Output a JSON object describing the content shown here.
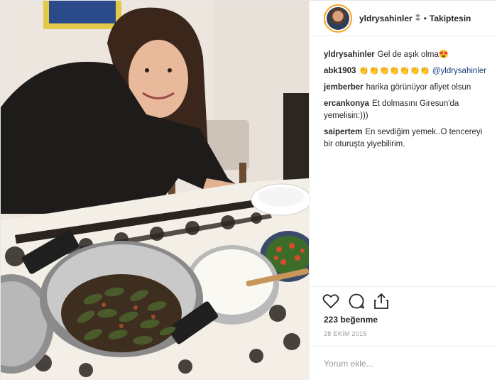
{
  "post": {
    "username": "yldrysahinler",
    "verified_glyph": "⭘",
    "follow_status": "Takiptesin",
    "likes": "223 beğenme",
    "date": "28 EKİM 2015",
    "comment_placeholder": "Yorum ekle..."
  },
  "comments": [
    {
      "user": "yldrysahinler",
      "text": "Gel de aşık olma😍",
      "mention": ""
    },
    {
      "user": "abk1903",
      "text": "👏👏👏👏👏👏👏 ",
      "mention": "@yldrysahinler"
    },
    {
      "user": "jemberber",
      "text": "harika görünüyor afiyet olsun",
      "mention": ""
    },
    {
      "user": "ercankonya",
      "text": "Et dolmasını Giresun'da yemelisin:)))",
      "mention": ""
    },
    {
      "user": "saipertem",
      "text": "En sevdiğim yemek..O tencereyi bir oturuşta yiyebilirim.",
      "mention": ""
    }
  ],
  "icons": {
    "like": "heart-icon",
    "comment": "comment-icon",
    "share": "share-icon"
  },
  "colors": {
    "accent_ring": "#f5a623",
    "mention": "#1a3d7c"
  }
}
